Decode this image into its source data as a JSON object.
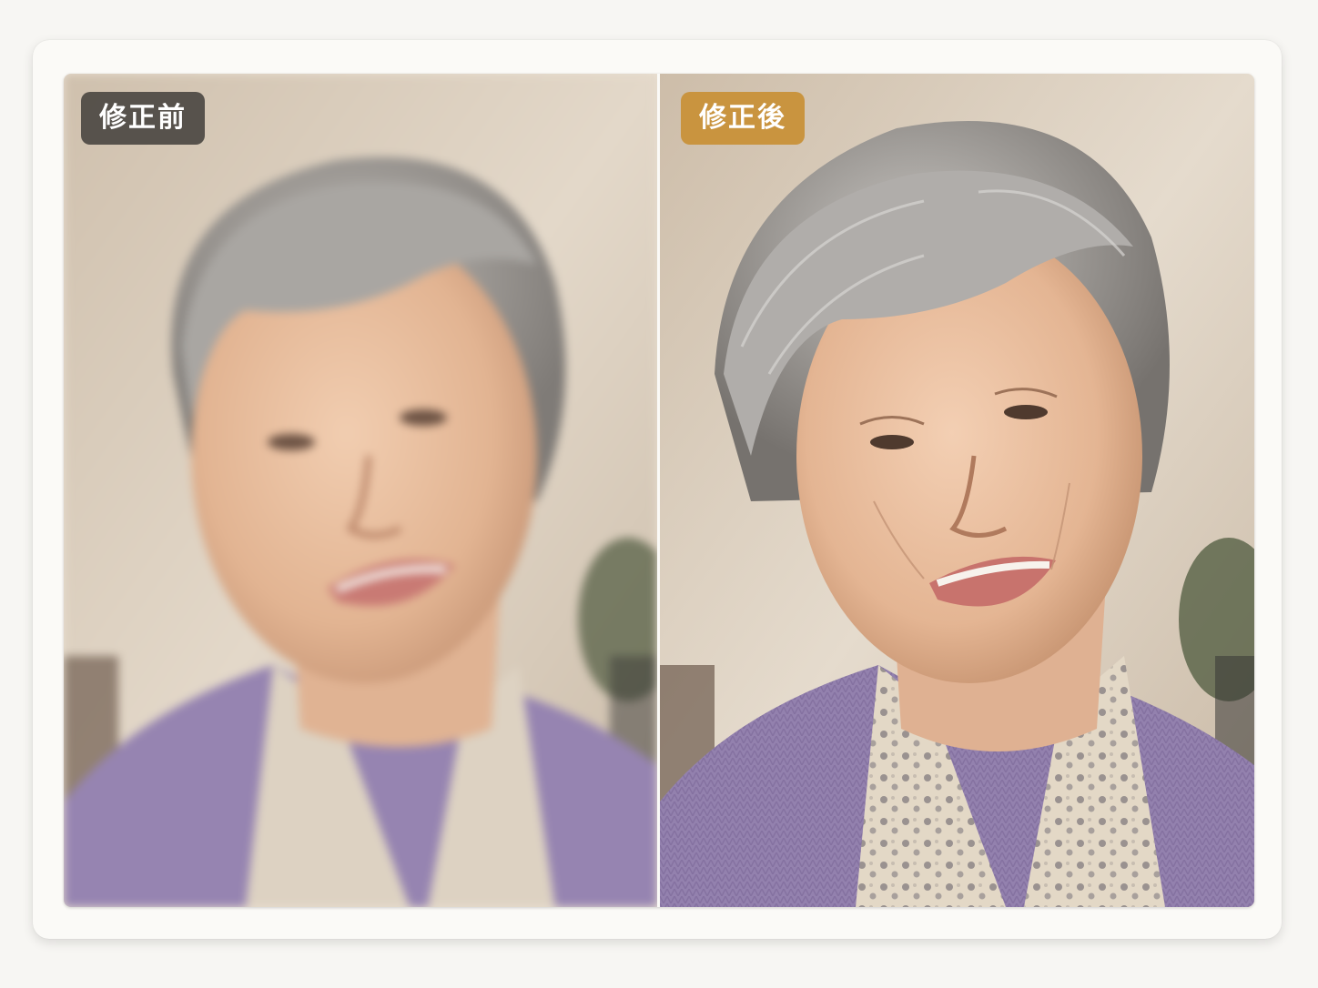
{
  "comparison": {
    "before": {
      "label": "修正前",
      "label_bg": "#46423e"
    },
    "after": {
      "label": "修正後",
      "label_bg": "#c9943f"
    }
  },
  "colors": {
    "wall": "#d9cbb9",
    "cardigan": "#9684b1",
    "hair": "#a19e9b",
    "skin": "#e9bf9f"
  }
}
